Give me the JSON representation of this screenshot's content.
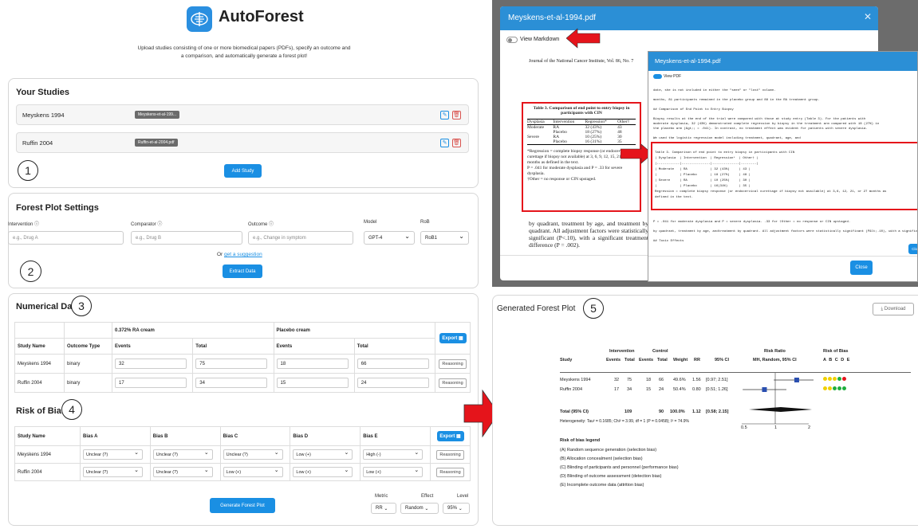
{
  "app": {
    "title": "AutoForest",
    "subtitle": "Upload studies consisting of one or more biomedical papers (PDFs), specify an outcome and a comparison, and automatically generate a forest plot!"
  },
  "studies": {
    "title": "Your Studies",
    "items": [
      {
        "name": "Meyskens 1994",
        "file": "Meyskens-et-al-199..."
      },
      {
        "name": "Ruffin 2004",
        "file": "Ruffin-et-al-2004.pdf"
      }
    ],
    "add": "Add Study"
  },
  "settings": {
    "title": "Forest Plot Settings",
    "intervention_label": "Intervention ⓘ",
    "comparator_label": "Comparator ⓘ",
    "outcome_label": "Outcome ⓘ",
    "model_label": "Model",
    "rob_label": "RoB",
    "intervention_ph": "e.g., Drug A",
    "comparator_ph": "e.g., Drug B",
    "outcome_ph": "e.g., Change in symptom",
    "model": "GPT-4",
    "rob": "RoB1",
    "or": "Or ",
    "suggest": "get a suggestion",
    "extract": "Extract Data"
  },
  "numerical": {
    "title": "Numerical Data",
    "group1": "0.372% RA cream",
    "group2": "Placebo cream",
    "cols": [
      "Study Name",
      "Outcome Type",
      "Events",
      "Total",
      "Events",
      "Total"
    ],
    "export": "Export ▦",
    "reasoning": "Reasoning",
    "rows": [
      {
        "name": "Meyskens 1994",
        "type": "binary",
        "e1": "32",
        "t1": "75",
        "e2": "18",
        "t2": "66"
      },
      {
        "name": "Ruffin 2004",
        "type": "binary",
        "e1": "17",
        "t1": "34",
        "e2": "15",
        "t2": "24"
      }
    ]
  },
  "rob": {
    "title": "Risk of Bias",
    "cols": [
      "Study Name",
      "Bias A",
      "Bias B",
      "Bias C",
      "Bias D",
      "Bias E"
    ],
    "export": "Export ▦",
    "reasoning": "Reasoning",
    "rows": [
      {
        "name": "Meyskens 1994",
        "v": [
          "Unclear (?)",
          "Unclear (?)",
          "Unclear (?)",
          "Low (+)",
          "High (-)"
        ]
      },
      {
        "name": "Ruffin 2004",
        "v": [
          "Unclear (?)",
          "Unclear (?)",
          "Low (+)",
          "Low (+)",
          "Low (+)"
        ]
      }
    ]
  },
  "generate": {
    "button": "Generate Forest Plot",
    "metric_label": "Metric",
    "effect_label": "Effect",
    "level_label": "Level",
    "metric": "RR",
    "effect": "Random",
    "level": "95%"
  },
  "markers": [
    "1",
    "2",
    "3",
    "4",
    "5"
  ],
  "pdf_modal": {
    "title": "Meyskens-et-al-1994.pdf",
    "toggle": "View Markdown",
    "journal": "Journal of the National Cancer Institute, Vol. 86, No. 7",
    "table_title": "Table 3. Comparison of end point to entry biopsy in participants with CIN",
    "table_head": [
      "Dysplasia",
      "Intervention",
      "Regression*",
      "Other†"
    ],
    "table_rows": [
      [
        "Moderate",
        "RA",
        "32 (43%)",
        "43"
      ],
      [
        "",
        "Placebo",
        "18 (27%)",
        "48"
      ],
      [
        "Severe",
        "RA",
        "10 (25%)",
        "30"
      ],
      [
        "",
        "Placebo",
        "16 (31%)",
        "35"
      ]
    ],
    "foot1": "*Regression = complete biopsy response (or endocervical curettage if biopsy not available) at 3, 6, 9, 12, 15, 21, or 27 months as defined in the text.",
    "foot2": "P = .041 for moderate dysplasia and P = .33 for severe dysplasia.",
    "foot3": "†Other = no response or CIN upstaged.",
    "body": "by quadrant, treatment by age, and treatment by quadrant. All adjustment factors were statistically significant (P<.10), with a significant treatment difference (P = .002).",
    "close": "Close"
  },
  "md_modal": {
    "title": "Meyskens-et-al-1994.pdf",
    "toggle": "View PDF",
    "lines": [
      "date, she is not included in either the \"seen\" or \"lost\" column.",
      "months, 81 participants remained in the placebo group and 88 in the RA treatment group.",
      "## Comparison of End Point to Entry Biopsy",
      "Biopsy results at the end of the trial were compared with those at study entry (Table 3). For the patients with",
      "moderate dysplasia, 32 (43%) demonstrated complete regression by biopsy in the treatment arm compared with 18 (27%) in",
      "the placebo arm (&gt;; = .041). In contrast, no treatment effect was evident for patients with severe dysplasia.",
      "We used the logistic regression model including treatment, quadrant, age, and"
    ],
    "table_lines": [
      "Table 3. Comparison of end point to entry biopsy in participants with CIN",
      "| Dysplasia  | Intervention  | Regression*  | Other† |",
      "|------------|---------------|--------------|--------|",
      "| Moderate   | RA            | 32 (43%)     | 43 |",
      "|            | Placebo       | 18 (27%)     | 48 |",
      "| Severe     | RA            | 10 (25%)     | 30 |",
      "|            | Placebo       | 16(31%)      | 35 |",
      "Regression = complete biopsy response (or endocervical curettage if biopsy not available) at 3,6, 12, 21, or 27 months as",
      "defined in the text."
    ],
    "after_lines": [
      "P = .041 for moderate dysplasia and P = severe dysplasia. .33 for †Other = no response or CIN upstaged.",
      "by quadrant, treatment by age, andtreatment by quadrant. All adjustment factors were statistically significant (P&lt;.10), with a significant treatment difference (P = .002).",
      "## Toxic Effects"
    ],
    "close": "Close"
  },
  "forest": {
    "title": "Generated Forest Plot",
    "download": "⤓ Download",
    "h_intervention": "Intervention",
    "h_control": "Control",
    "h_rr": "Risk Ratio",
    "h_rob": "Risk of Bias",
    "cols": [
      "Study",
      "Events",
      "Total",
      "Events",
      "Total",
      "Weight",
      "RR",
      "95% CI"
    ],
    "rr_sub": "MH, Random, 95% CI",
    "rob_letters": "A B C D E",
    "rows": [
      {
        "study": "Meyskens 1994",
        "e1": "32",
        "t1": "75",
        "e2": "18",
        "t2": "66",
        "w": "49.6%",
        "rr": "1.56",
        "ci": "[0.97; 2.51]"
      },
      {
        "study": "Ruffin 2004",
        "e1": "17",
        "t1": "34",
        "e2": "15",
        "t2": "24",
        "w": "50.4%",
        "rr": "0.80",
        "ci": "[0.51; 1.26]"
      }
    ],
    "total": {
      "label": "Total (95% CI)",
      "t1": "109",
      "t2": "90",
      "w": "100.0%",
      "rr": "1.12",
      "ci": "[0.58; 2.15]"
    },
    "het": "Heterogeneity: Tau² = 0.1685; Chi² = 3.99, df = 1 (P = 0.0458); I² = 74.9%",
    "axis": [
      "0.5",
      "1",
      "2"
    ],
    "legend_title": "Risk of bias legend",
    "legend": [
      "(A) Random sequence generation (selection bias)",
      "(B) Allocation concealment (selection bias)",
      "(C) Blinding of participants and personnel (performance bias)",
      "(D) Blinding of outcome assessment (detection bias)",
      "(E) Incomplete outcome data (attrition bias)"
    ]
  },
  "colors": {
    "accent": "#1a8fe3",
    "modal_header": "#2b8fd6",
    "arrow": "#e5141b"
  }
}
